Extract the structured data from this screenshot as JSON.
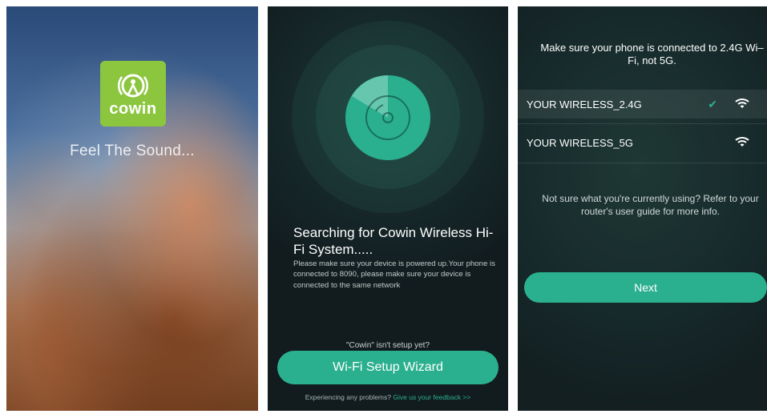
{
  "colors": {
    "accent": "#2bb08f",
    "logo_green": "#8cc63f",
    "dark_bg": "#16282a"
  },
  "splash": {
    "logo_text": "cowin",
    "logo_icon": "speaker-wave-icon",
    "tagline": "Feel The Sound..."
  },
  "search": {
    "title": "Searching for Cowin Wireless Hi-Fi System.....",
    "body": "Please make sure your device is powered up.Your phone is connected to 8090, please make sure your device is connected to the same network",
    "setup_question": "\"Cowin\" isn't setup yet?",
    "wizard_label": "Wi-Fi Setup Wizard",
    "footer_text": "Experiencing any problems?",
    "footer_link": "Give us your feedback >>"
  },
  "wifi": {
    "notice": "Make sure your phone is connected to 2.4G Wi–Fi, not 5G.",
    "networks": [
      {
        "name": "YOUR WIRELESS_2.4G",
        "selected": true
      },
      {
        "name": "YOUR WIRELESS_5G",
        "selected": false
      }
    ],
    "help": "Not sure what you're currently using? Refer to your router's user guide for more info.",
    "next_label": "Next"
  }
}
